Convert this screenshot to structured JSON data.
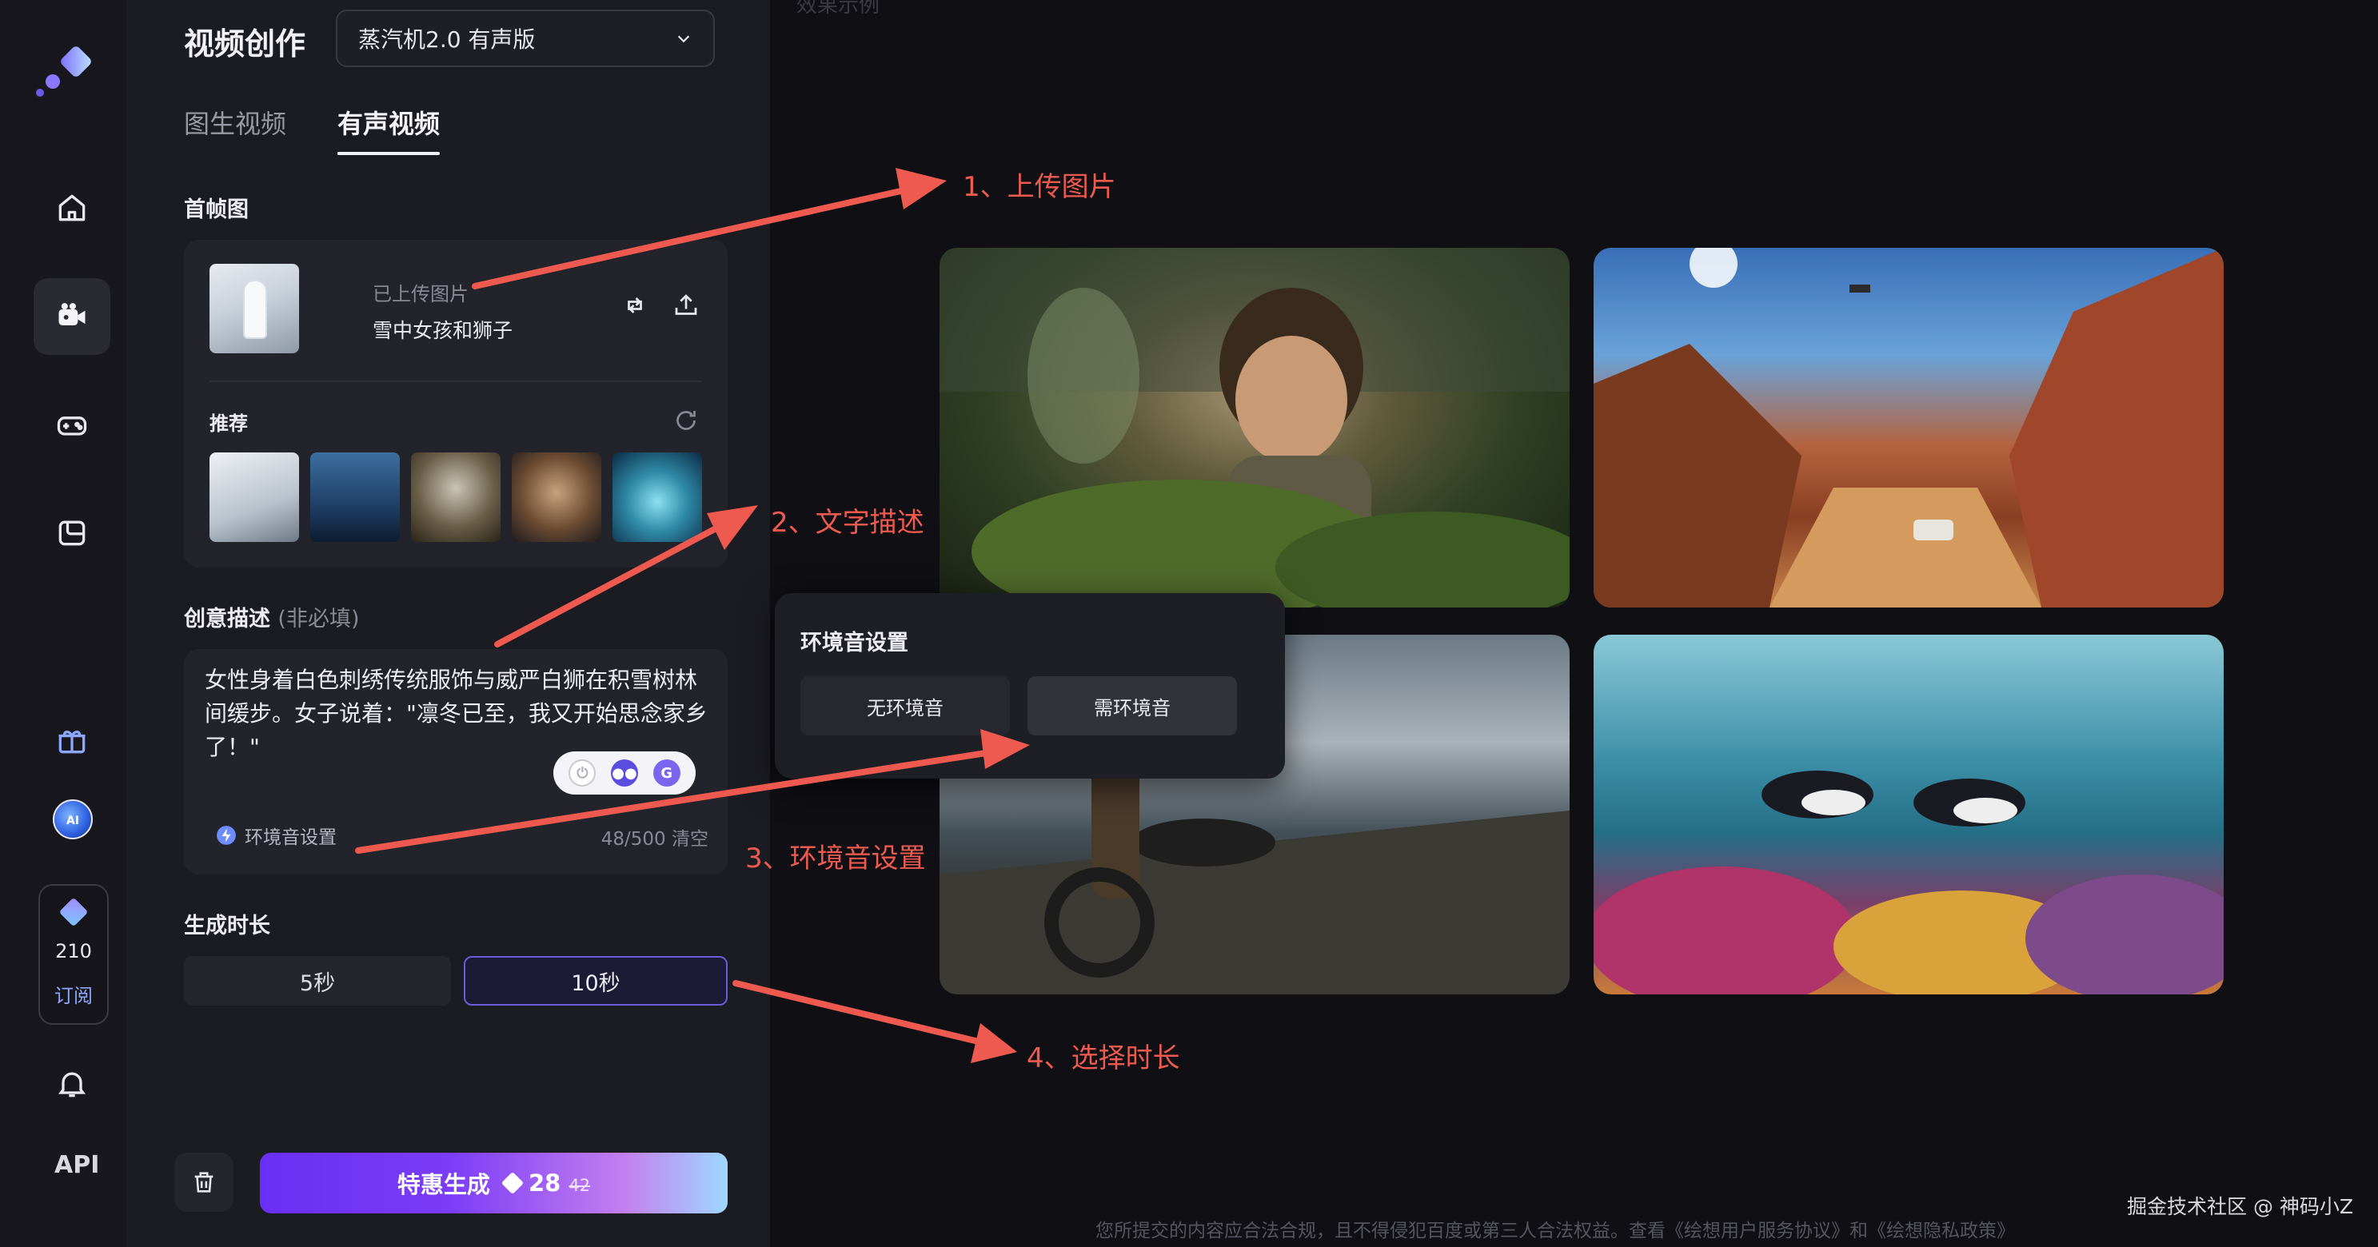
{
  "rail": {
    "nav": [
      "home",
      "video-create",
      "game",
      "gallery"
    ],
    "ai_badge": "AI",
    "credits": "210",
    "subscribe_label": "订阅",
    "api_label": "API"
  },
  "panel": {
    "title": "视频创作",
    "model_select": "蒸汽机2.0 有声版",
    "tabs": [
      {
        "label": "图生视频",
        "active": false
      },
      {
        "label": "有声视频",
        "active": true
      }
    ],
    "first_frame": {
      "label": "首帧图",
      "state": "已上传图片",
      "name": "雪中女孩和狮子",
      "recommend_label": "推荐"
    },
    "description": {
      "label": "创意描述",
      "hint": "(非必填)",
      "text": "女性身着白色刺绣传统服饰与威严白狮在积雪树林间缓步。女子说着：\"凛冬已至，我又开始思念家乡了！\"",
      "env_toggle": "环境音设置",
      "char_count": "48/500",
      "clear_label": "清空",
      "pill_g": "G"
    },
    "duration": {
      "label": "生成时长",
      "options": [
        {
          "label": "5秒",
          "selected": false
        },
        {
          "label": "10秒",
          "selected": true
        }
      ]
    },
    "generate": {
      "label": "特惠生成",
      "price": "28",
      "original_price": "42"
    }
  },
  "popover": {
    "title": "环境音设置",
    "options": [
      "无环境音",
      "需环境音"
    ]
  },
  "gallery": {
    "faded_heading": "效果示例",
    "tiles": [
      "greenhouse-boy",
      "canyon-car",
      "motorbike-helicopter",
      "coral-penguins"
    ]
  },
  "annotations": [
    "1、上传图片",
    "2、文字描述",
    "3、环境音设置",
    "4、选择时长"
  ],
  "footer": "您所提交的内容应合法合规，且不得侵犯百度或第三人合法权益。查看《绘想用户服务协议》和《绘想隐私政策》",
  "watermark": "掘金技术社区 @ 神码小Z",
  "colors": {
    "accent": "#6b5bd8",
    "annotation": "#ee5a4f",
    "background": "#0f0f14"
  }
}
